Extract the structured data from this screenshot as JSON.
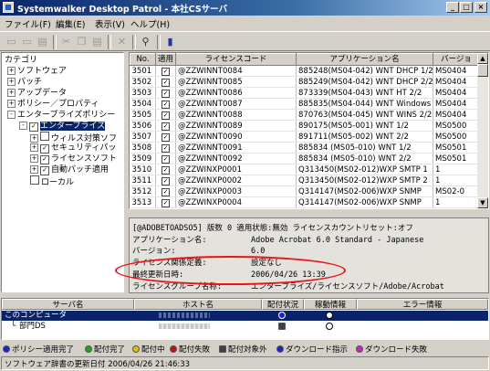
{
  "window": {
    "title": "Systemwalker Desktop Patrol - 本社CSサーバ"
  },
  "menu": [
    "ファイル(F)",
    "編集(E)",
    "表示(V)",
    "ヘルプ(H)"
  ],
  "tree": {
    "root_label": "カテゴリ",
    "items": [
      {
        "label": "ソフトウェア",
        "expander": "+",
        "level": 0
      },
      {
        "label": "パッチ",
        "expander": "+",
        "level": 0
      },
      {
        "label": "アップデータ",
        "expander": "+",
        "level": 0
      },
      {
        "label": "ポリシー／プロパティ",
        "expander": "+",
        "level": 0
      },
      {
        "label": "エンタープライズポリシー",
        "expander": "-",
        "level": 0
      },
      {
        "label": "エンタープライズ",
        "expander": "-",
        "level": 1,
        "checked": true,
        "selected": true
      },
      {
        "label": "ウィルス対策ソフ",
        "expander": "+",
        "level": 2,
        "checked": false
      },
      {
        "label": "セキュリティパッ",
        "expander": "+",
        "level": 2,
        "checked": true
      },
      {
        "label": "ライセンスソフト",
        "expander": "+",
        "level": 2,
        "checked": true
      },
      {
        "label": "自動パッチ適用",
        "expander": "+",
        "level": 2,
        "checked": true
      },
      {
        "label": "ローカル",
        "expander": "",
        "level": 1,
        "checked": false
      }
    ]
  },
  "grid": {
    "columns": [
      "No.",
      "適用",
      "ライセンスコード",
      "アプリケーション名",
      "バージョ"
    ],
    "rows": [
      [
        "3501",
        "@ZZWINNT0084",
        "885248(MS04-042) WNT DHCP 1/2",
        "MS0404"
      ],
      [
        "3502",
        "@ZZWINNT0085",
        "885249(MS04-042) WNT DHCP 2/2",
        "MS0404"
      ],
      [
        "3503",
        "@ZZWINNT0086",
        "873339(MS04-043) WNT HT 2/2",
        "MS0404"
      ],
      [
        "3504",
        "@ZZWINNT0087",
        "885835(MS04-044) WNT Windows",
        "MS0404"
      ],
      [
        "3505",
        "@ZZWINNT0088",
        "870763(MS04-045) WNT WINS 2/2",
        "MS0404"
      ],
      [
        "3506",
        "@ZZWINNT0089",
        "890175(MS05-001) WNT 1/2",
        "MS0500"
      ],
      [
        "3507",
        "@ZZWINNT0090",
        "891711(MS05-002) WNT 2/2",
        "MS0500"
      ],
      [
        "3508",
        "@ZZWINNT0091",
        "885834 (MS05-010) WNT 1/2",
        "MS0501"
      ],
      [
        "3509",
        "@ZZWINNT0092",
        "885834 (MS05-010) WNT 2/2",
        "MS0501"
      ],
      [
        "3510",
        "@ZZWINXP0001",
        "Q313450(MS02-012)WXP SMTP 1",
        "1"
      ],
      [
        "3511",
        "@ZZWINXP0002",
        "Q313450(MS02-012)WXP SMTP 2",
        "1"
      ],
      [
        "3512",
        "@ZZWINXP0003",
        "Q314147(MS02-006)WXP SNMP",
        "MS02-0"
      ],
      [
        "3513",
        "@ZZWINXP0004",
        "Q314147(MS02-006)WXP SNMP",
        "1"
      ],
      [
        "3514",
        "@ZZWINXP0005",
        "Q315000(MS01-059)WXP UPnP",
        "1"
      ]
    ]
  },
  "details": {
    "title": "[@ADOBETOADSO5]    版数 0  適用状態:無効  ライセンスカウントリセット:オフ",
    "fields": [
      {
        "label": "アプリケーション名:",
        "value": "Adobe Acrobat 6.0 Standard - Japanese"
      },
      {
        "label": "バージョン:",
        "value": "6.0"
      },
      {
        "label": "ライセンス関係定義:",
        "value": "設定なし"
      },
      {
        "label": "最終更新日時:",
        "value": "2006/04/26 13:39"
      },
      {
        "label": "ライセンスグループ名称:",
        "value": "エンタープライズ/ライセンスソフト/Adobe/Acrobat"
      }
    ]
  },
  "servers": {
    "columns": [
      "サーバ名",
      "ホスト名",
      "配付状況",
      "稼動情報",
      "エラー情報"
    ],
    "rows": [
      {
        "name": "このコンピュータ",
        "selected": true
      },
      {
        "name": "部門DS",
        "selected": false
      }
    ]
  },
  "legend": [
    {
      "label": "ポリシー適用完了",
      "color": "#2020d0"
    },
    {
      "label": "配付完了",
      "color": "#20a020"
    },
    {
      "label": "配付中",
      "color": "#e0c000"
    },
    {
      "label": "配付失敗",
      "color": "#c01010"
    },
    {
      "label": "配付対象外",
      "color": "#404040"
    },
    {
      "label": "ダウンロード指示",
      "color": "#2020d0"
    },
    {
      "label": "ダウンロード失敗",
      "color": "#d020c0"
    }
  ],
  "status": {
    "text": "ソフトウェア辞書の更新日付 2006/04/26 21:46:33"
  }
}
